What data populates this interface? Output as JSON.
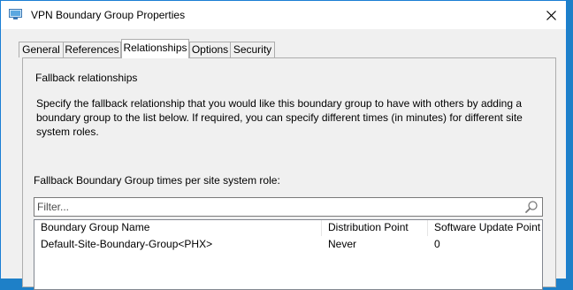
{
  "window": {
    "title": "VPN Boundary Group Properties",
    "icons": {
      "app": "boundary-group-icon",
      "close": "close-icon"
    }
  },
  "tabs": [
    {
      "label": "General",
      "active": false
    },
    {
      "label": "References",
      "active": false
    },
    {
      "label": "Relationships",
      "active": true
    },
    {
      "label": "Options",
      "active": false
    },
    {
      "label": "Security",
      "active": false
    }
  ],
  "relationships": {
    "section_label": "Fallback relationships",
    "description": "Specify the fallback relationship that you would like this boundary group to have with others by adding a boundary group to the list below. If required, you can specify different times (in minutes) for different site system roles.",
    "times_label": "Fallback Boundary Group times per site system role:",
    "filter": {
      "placeholder": "Filter...",
      "value": "",
      "icon": "search-icon"
    },
    "columns": [
      "Boundary Group Name",
      "Distribution Point",
      "Software Update Point"
    ],
    "rows": [
      [
        "Default-Site-Boundary-Group<PHX>",
        "Never",
        "0"
      ]
    ]
  },
  "colors": {
    "accent_border": "#1a7ed4",
    "desktop": "#1e80c8",
    "dialog_bg": "#f0f0f0"
  }
}
